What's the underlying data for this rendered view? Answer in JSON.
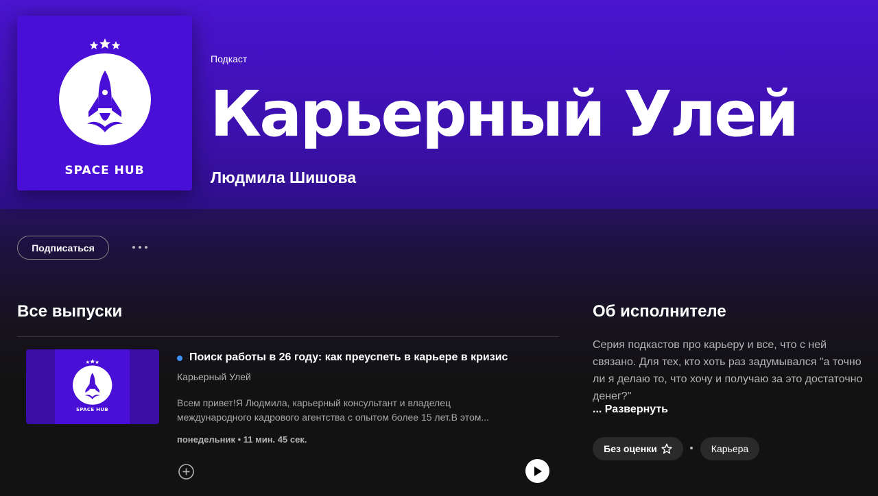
{
  "header": {
    "type_label": "Подкаст",
    "title": "Карьерный Улей",
    "author": "Людмила Шишова",
    "cover_text": "SPACE HUB"
  },
  "actions": {
    "subscribe_label": "Подписаться",
    "more_icon": "more-options-icon"
  },
  "episodes_section": {
    "title": "Все выпуски",
    "episodes": [
      {
        "title": "Поиск работы в 26 году: как преуспеть в карьере в кризис",
        "show": "Карьерный Улей",
        "description_line1": "Всем привет!Я Людмила, карьерный консультант и владелец",
        "description_line2": "международного кадрового агентства с опытом более 15 лет.В этом...",
        "meta": "понедельник • 11 мин. 45 сек.",
        "art_text": "SPACE HUB",
        "new_indicator_color": "#3d91f4"
      }
    ]
  },
  "about": {
    "title": "Об исполнителе",
    "text": "Серия подкастов про карьеру и все, что с ней связано. Для тех, кто хоть раз задумывался \"а точно ли я делаю то, что хочу и получаю за это достаточно денег?\"",
    "expand_label": "... Развернуть",
    "rating_label": "Без оценки",
    "category": "Карьера"
  },
  "colors": {
    "cover_bg": "#4a0fd6",
    "hero_bg": "#4a14d0",
    "page_bg": "#121212"
  }
}
